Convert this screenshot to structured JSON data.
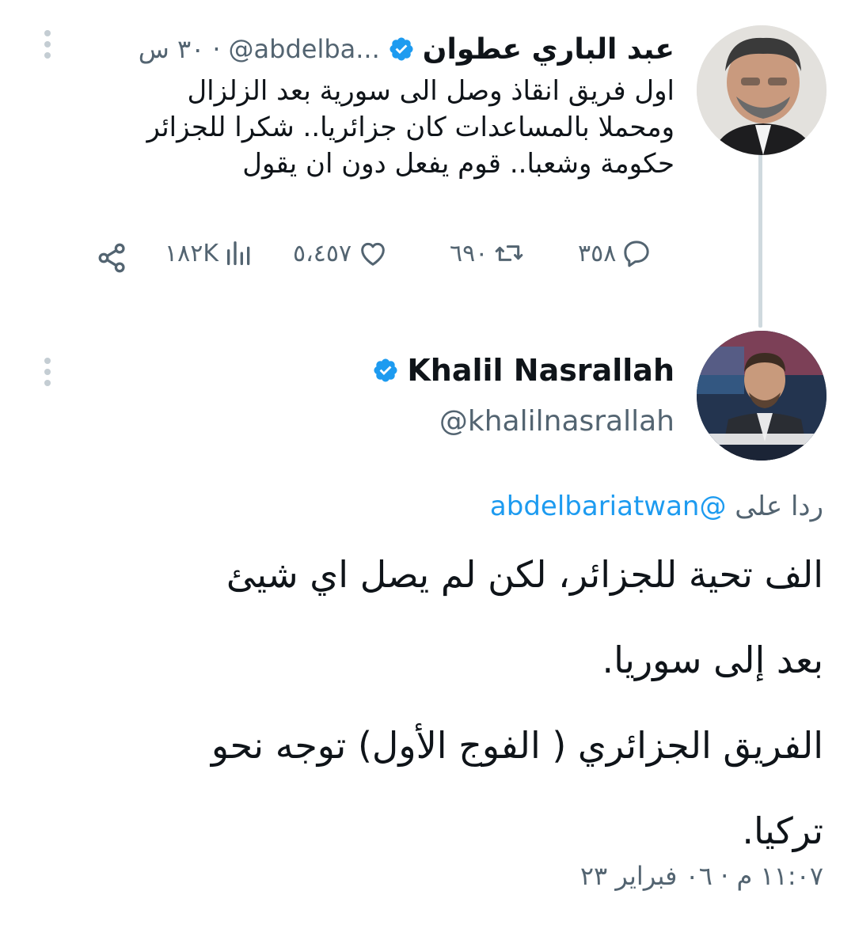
{
  "original_tweet": {
    "author_name": "عبد الباري عطوان",
    "handle": "@abdelba...",
    "separator": "·",
    "time": "٣٠ س",
    "text_lines": [
      "اول فريق انقاذ وصل الى سورية بعد الزلزال",
      "ومحملا بالمساعدات كان جزائريا.. شكرا للجزائر",
      "حكومة وشعبا.. قوم يفعل دون ان يقول"
    ],
    "replies": "٣٥٨",
    "retweets": "٦٩٠",
    "likes": "٥،٤٥٧",
    "views": "١٨٢K"
  },
  "reply_tweet": {
    "author_name": "Khalil Nasrallah",
    "handle": "@khalilnasrallah",
    "reply_prefix": "ردا على",
    "reply_mention": "@abdelbariatwan",
    "text_lines": [
      "الف تحية للجزائر، لكن لم يصل اي شيئ",
      "بعد إلى سوريا.",
      "الفريق الجزائري ( الفوج الأول) توجه نحو",
      "تركيا."
    ],
    "timestamp": "١١:٠٧ م · ٠٦ فبراير ٢٣"
  },
  "icons": {
    "verified": "verified-badge-icon",
    "reply": "reply-icon",
    "retweet": "retweet-icon",
    "like": "heart-icon",
    "views": "views-icon",
    "share": "share-icon",
    "more": "more-vertical-icon"
  },
  "colors": {
    "text": "#0f1419",
    "secondary": "#536471",
    "link": "#1d9bf0",
    "verified": "#1d9bf0",
    "thread_line": "#cfd9de"
  }
}
